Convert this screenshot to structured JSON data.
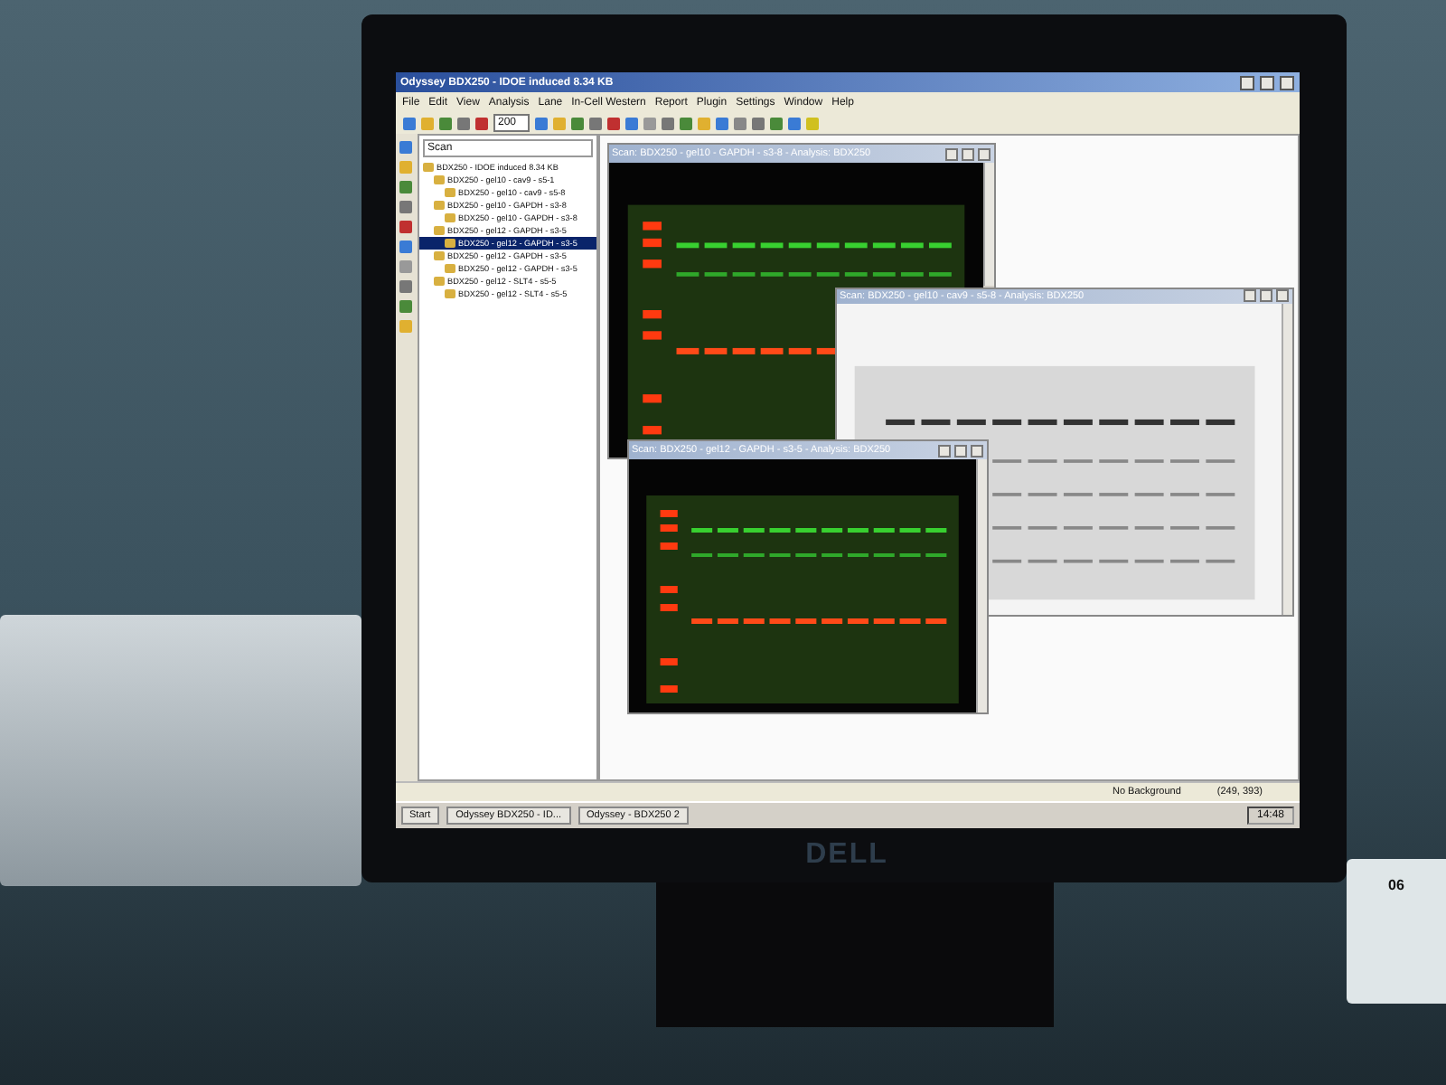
{
  "app": {
    "title": "Odyssey BDX250 - IDOE induced 8.34 KB",
    "menu": [
      "File",
      "Edit",
      "View",
      "Analysis",
      "Lane",
      "In-Cell Western",
      "Report",
      "Plugin",
      "Settings",
      "Window",
      "Help"
    ],
    "zoom": "200",
    "tree": {
      "search": "Scan",
      "items": [
        {
          "label": "BDX250 - IDOE induced 8.34 KB",
          "selected": false,
          "children": [
            {
              "label": "BDX250 - gel10 - cav9 - s5-1",
              "selected": false,
              "children": [
                {
                  "label": "BDX250 - gel10 - cav9 - s5-8",
                  "selected": false
                }
              ]
            },
            {
              "label": "BDX250 - gel10 - GAPDH - s3-8",
              "selected": false,
              "children": [
                {
                  "label": "BDX250 - gel10 - GAPDH - s3-8",
                  "selected": false
                }
              ]
            },
            {
              "label": "BDX250 - gel12 - GAPDH - s3-5",
              "selected": false,
              "children": [
                {
                  "label": "BDX250 - gel12 - GAPDH - s3-5",
                  "selected": true
                }
              ]
            },
            {
              "label": "BDX250 - gel12 - GAPDH - s3-5",
              "selected": false,
              "children": [
                {
                  "label": "BDX250 - gel12 - GAPDH - s3-5",
                  "selected": false
                }
              ]
            },
            {
              "label": "BDX250 - gel12 - SLT4 - s5-5",
              "selected": false,
              "children": [
                {
                  "label": "BDX250 - gel12 - SLT4 - s5-5",
                  "selected": false
                }
              ]
            }
          ]
        }
      ]
    }
  },
  "scan_windows": [
    {
      "title": "Scan: BDX250 - gel10 - GAPDH - s3-8 - Analysis: BDX250",
      "kind": "fluorescent"
    },
    {
      "title": "Scan: BDX250 - gel10 - cav9 - s5-8 - Analysis: BDX250",
      "kind": "grayscale"
    },
    {
      "title": "Scan: BDX250 - gel12 - GAPDH - s3-5 - Analysis: BDX250",
      "kind": "fluorescent"
    }
  ],
  "status_bar": [
    "No Background",
    "(249, 393)"
  ],
  "taskbar": {
    "start": "Start",
    "tasks": [
      "Odyssey BDX250 - ID...",
      "Odyssey - BDX250 2"
    ],
    "clock": "14:48"
  },
  "monitor": {
    "brand": "DELL"
  },
  "device_label": "06"
}
